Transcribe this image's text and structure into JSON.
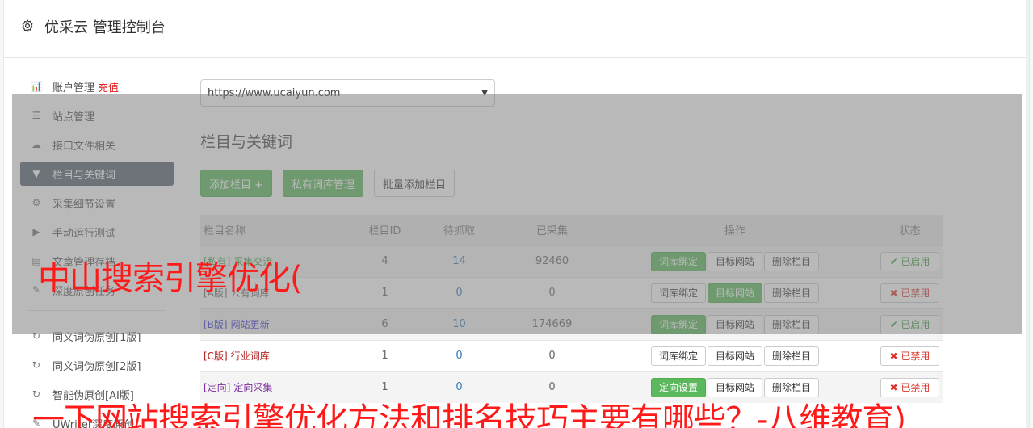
{
  "header": {
    "title": "优采云 管理控制台"
  },
  "sidebar": {
    "items": [
      {
        "label": "账户管理",
        "extra": "充值",
        "icon": "bar-chart-icon",
        "glyph": "📊",
        "active": false
      },
      {
        "label": "站点管理",
        "icon": "server-icon",
        "glyph": "☰",
        "active": false
      },
      {
        "label": "接口文件相关",
        "icon": "cloud-upload-icon",
        "glyph": "☁",
        "active": false
      },
      {
        "label": "栏目与关键词",
        "icon": "filter-icon",
        "glyph": "▼",
        "active": true
      },
      {
        "label": "采集细节设置",
        "icon": "cogs-icon",
        "glyph": "⚙",
        "active": false
      },
      {
        "label": "手动运行测试",
        "icon": "play-circle-icon",
        "glyph": "▶",
        "active": false
      },
      {
        "label": "文章管理存档",
        "icon": "database-icon",
        "glyph": "▤",
        "active": false
      },
      {
        "label": "深度原创任务",
        "icon": "edit-icon",
        "glyph": "✎",
        "active": false
      }
    ],
    "items2": [
      {
        "label": "同义词伪原创[1版]",
        "icon": "refresh-icon",
        "glyph": "↻"
      },
      {
        "label": "同义词伪原创[2版]",
        "icon": "refresh-icon",
        "glyph": "↻"
      },
      {
        "label": "智能伪原创[AI版]",
        "icon": "refresh-icon",
        "glyph": "↻"
      },
      {
        "label": "UWriter深度原创",
        "icon": "edit-icon",
        "glyph": "✎"
      }
    ]
  },
  "main": {
    "site_select_value": "https://www.ucaiyun.com",
    "section_title": "栏目与关键词",
    "buttons": {
      "add_column": "添加栏目 +",
      "private_lexicon": "私有词库管理",
      "batch_add": "批量添加栏目"
    },
    "table": {
      "headers": [
        "栏目名称",
        "栏目ID",
        "待抓取",
        "已采集",
        "操作",
        "状态"
      ],
      "rows": [
        {
          "tag": "[私有]",
          "name": "采集交流",
          "tag_color": "#3c9a3c",
          "id": "4",
          "pending": "14",
          "collected": "92460",
          "op1": "词库绑定",
          "op1_active": true,
          "op2": "目标网站",
          "op2_active": false,
          "op3": "删除栏目",
          "status": "✔ 已启用",
          "status_on": true
        },
        {
          "tag": "[A版]",
          "name": "公有词库",
          "tag_color": "#666666",
          "id": "1",
          "pending": "0",
          "collected": "0",
          "op1": "词库绑定",
          "op1_active": false,
          "op2": "目标网站",
          "op2_active": true,
          "op3": "删除栏目",
          "status": "✖ 已禁用",
          "status_on": false
        },
        {
          "tag": "[B版]",
          "name": "网站更新",
          "tag_color": "#3a3ad0",
          "id": "6",
          "pending": "10",
          "collected": "174669",
          "op1": "词库绑定",
          "op1_active": true,
          "op2": "目标网站",
          "op2_active": false,
          "op3": "删除栏目",
          "status": "✔ 已启用",
          "status_on": true
        },
        {
          "tag": "[C版]",
          "name": "行业词库",
          "tag_color": "#b02020",
          "id": "1",
          "pending": "0",
          "collected": "0",
          "op1": "词库绑定",
          "op1_active": false,
          "op2": "目标网站",
          "op2_active": false,
          "op3": "删除栏目",
          "status": "✖ 已禁用",
          "status_on": false
        },
        {
          "tag": "[定向]",
          "name": "定向采集",
          "tag_color": "#7a2a9a",
          "id": "1",
          "pending": "0",
          "collected": "0",
          "op1": "定向设置",
          "op1_active": true,
          "op2": "目标网站",
          "op2_active": false,
          "op3": "删除栏目",
          "status": "✖ 已禁用",
          "status_on": false
        }
      ]
    }
  },
  "overlay": {
    "text1": "中山搜索引擎优化(",
    "text2": "一下网站搜索引擎优化方法和排名技巧主要有哪些？-八维教育)"
  }
}
